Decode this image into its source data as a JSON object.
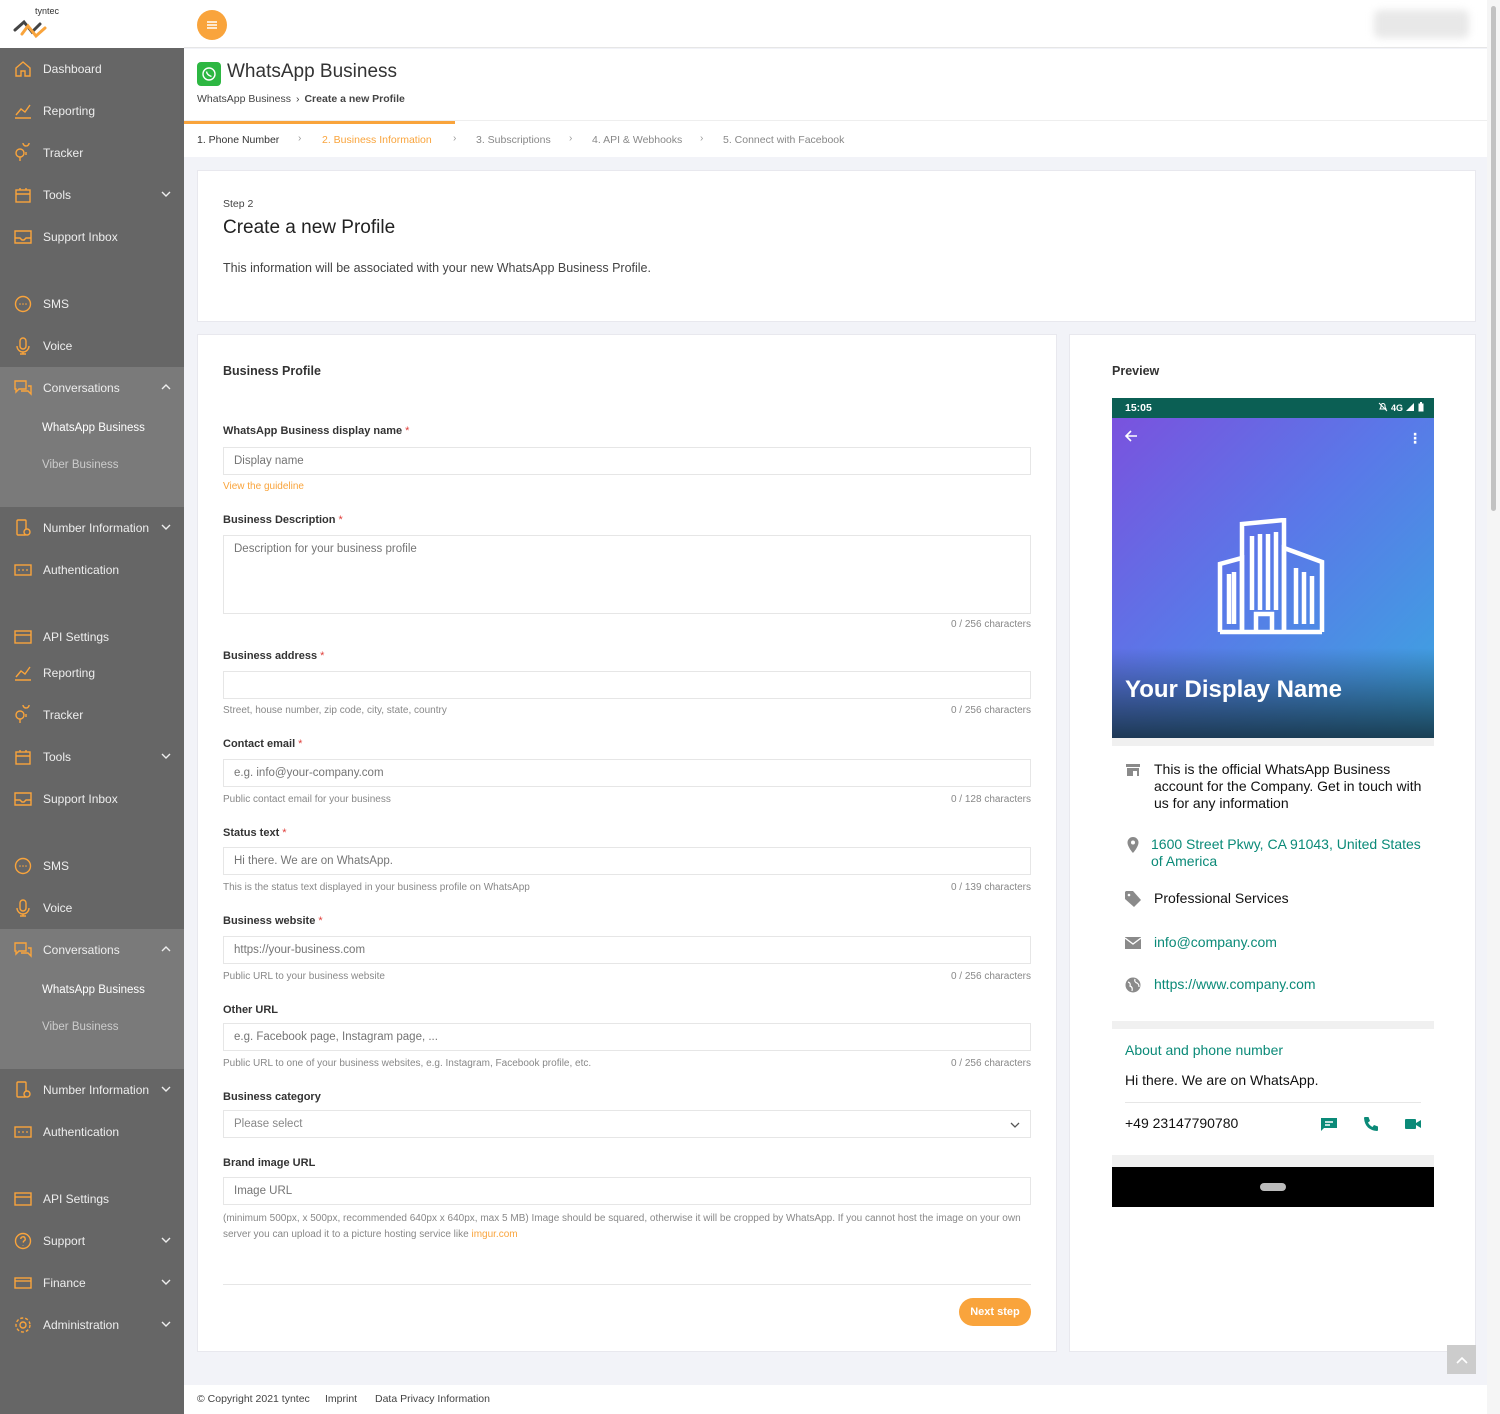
{
  "brand": {
    "logo_text": "tyntec"
  },
  "sidebar": {
    "group1": [
      {
        "label": "Dashboard",
        "icon": "home-icon"
      },
      {
        "label": "Reporting",
        "icon": "chart-line-icon"
      },
      {
        "label": "Tracker",
        "icon": "map-pin-icon"
      },
      {
        "label": "Tools",
        "icon": "tools-icon"
      },
      {
        "label": "Support Inbox",
        "icon": "inbox-icon"
      },
      {
        "label": "SMS",
        "icon": "sms-chat-icon"
      },
      {
        "label": "Voice",
        "icon": "microphone-icon"
      },
      {
        "label": "Conversations",
        "icon": "conversations-icon"
      },
      {
        "label": "WhatsApp Business"
      },
      {
        "label": "Viber Business"
      },
      {
        "label": "Number Information",
        "icon": "phone-info-icon"
      },
      {
        "label": "Authentication",
        "icon": "password-icon"
      },
      {
        "label": "API Settings",
        "icon": "api-icon"
      }
    ],
    "group2": [
      {
        "label": "Reporting"
      },
      {
        "label": "Tracker"
      },
      {
        "label": "Tools"
      },
      {
        "label": "Support Inbox"
      },
      {
        "label": "SMS"
      },
      {
        "label": "Voice"
      },
      {
        "label": "Conversations"
      },
      {
        "label": "WhatsApp Business"
      },
      {
        "label": "Viber Business"
      },
      {
        "label": "Number Information"
      },
      {
        "label": "Authentication"
      },
      {
        "label": "API Settings"
      },
      {
        "label": "Support",
        "icon": "help-circle-icon"
      },
      {
        "label": "Finance",
        "icon": "credit-card-icon"
      },
      {
        "label": "Administration",
        "icon": "gear-icon"
      }
    ]
  },
  "header": {
    "title": "WhatsApp Business",
    "breadcrumb": {
      "parent": "WhatsApp Business",
      "current": "Create a new Profile"
    },
    "steps": [
      "1. Phone Number",
      "2. Business Information",
      "3. Subscriptions",
      "4. API & Webhooks",
      "5. Connect with Facebook"
    ]
  },
  "intro": {
    "step": "Step 2",
    "title": "Create a new Profile",
    "description": "This information will be associated with your new WhatsApp Business Profile."
  },
  "form": {
    "section_title": "Business Profile",
    "required_mark": "*",
    "display_name": {
      "label": "WhatsApp Business display name",
      "placeholder": "Display name",
      "guideline": "View the guideline"
    },
    "description": {
      "label": "Business Description",
      "placeholder": "Description for your business profile",
      "count": "0 / 256 characters"
    },
    "address": {
      "label": "Business address",
      "help": "Street, house number, zip code, city, state, country",
      "count": "0 / 256 characters"
    },
    "email": {
      "label": "Contact email",
      "placeholder": "e.g. info@your-company.com",
      "help": "Public contact email for your business",
      "count": "0 / 128 characters"
    },
    "status": {
      "label": "Status text",
      "placeholder": "Hi there. We are on WhatsApp.",
      "help": "This is the status text displayed in your business profile on WhatsApp",
      "count": "0 / 139 characters"
    },
    "website": {
      "label": "Business website",
      "placeholder": "https://your-business.com",
      "help": "Public URL to your business website",
      "count": "0 / 256 characters"
    },
    "other_url": {
      "label": "Other URL",
      "placeholder": "e.g. Facebook page, Instagram page, ...",
      "help": "Public URL to one of your business websites, e.g. Instagram, Facebook profile, etc.",
      "count": "0 / 256 characters"
    },
    "category": {
      "label": "Business category",
      "value": "Please select"
    },
    "brand_image": {
      "label": "Brand image URL",
      "placeholder": "Image URL",
      "help": "(minimum 500px, x 500px, recommended 640px x 640px, max 5 MB) Image should be squared, otherwise it will be cropped by WhatsApp. If you cannot host the image on your own server you can upload it to a picture hosting service like",
      "help_link": "imgur.com"
    },
    "next_label": "Next step"
  },
  "preview": {
    "title": "Preview",
    "time": "15:05",
    "status_icons": "4G",
    "display_name": "Your Display Name",
    "description": "This is the official WhatsApp Business account for the Company. Get in touch with us for any information",
    "address": "1600 Street Pkwy, CA 91043, United States of America",
    "category": "Professional Services",
    "email": "info@company.com",
    "website": "https://www.company.com",
    "about_title": "About and phone number",
    "status_text": "Hi there. We are on WhatsApp.",
    "phone": "+49 23147790780"
  },
  "footer": {
    "copyright": "© Copyright 2021 tyntec",
    "imprint": "Imprint",
    "privacy": "Data Privacy Information"
  },
  "colors": {
    "accent": "#f9a43c",
    "sidebar": "#666666",
    "whatsapp_teal": "#0b8a78",
    "required": "#e0403c"
  }
}
